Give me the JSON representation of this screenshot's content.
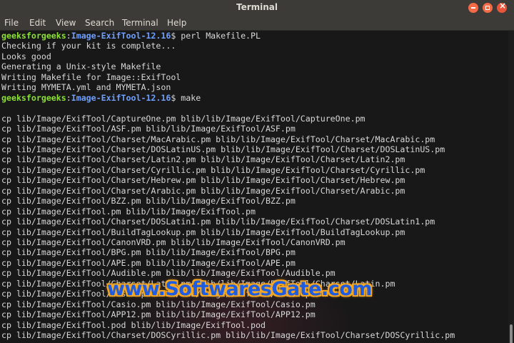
{
  "window": {
    "title": "Terminal"
  },
  "menu": [
    "File",
    "Edit",
    "View",
    "Search",
    "Terminal",
    "Help"
  ],
  "prompt": {
    "user": "geeksforgeeks",
    "path": "Image-ExifTool-12.16"
  },
  "lines": [
    {
      "type": "prompt",
      "cmd": " perl Makefile.PL"
    },
    {
      "type": "out",
      "text": "Checking if your kit is complete..."
    },
    {
      "type": "out",
      "text": "Looks good"
    },
    {
      "type": "out",
      "text": "Generating a Unix-style Makefile"
    },
    {
      "type": "out",
      "text": "Writing Makefile for Image::ExifTool"
    },
    {
      "type": "out",
      "text": "Writing MYMETA.yml and MYMETA.json"
    },
    {
      "type": "prompt",
      "cmd": " make"
    },
    {
      "type": "out",
      "text": ""
    },
    {
      "type": "out",
      "text": "cp lib/Image/ExifTool/CaptureOne.pm blib/lib/Image/ExifTool/CaptureOne.pm"
    },
    {
      "type": "out",
      "text": "cp lib/Image/ExifTool/ASF.pm blib/lib/Image/ExifTool/ASF.pm"
    },
    {
      "type": "out",
      "text": "cp lib/Image/ExifTool/Charset/MacArabic.pm blib/lib/Image/ExifTool/Charset/MacArabic.pm"
    },
    {
      "type": "out",
      "text": "cp lib/Image/ExifTool/Charset/DOSLatinUS.pm blib/lib/Image/ExifTool/Charset/DOSLatinUS.pm"
    },
    {
      "type": "out",
      "text": "cp lib/Image/ExifTool/Charset/Latin2.pm blib/lib/Image/ExifTool/Charset/Latin2.pm"
    },
    {
      "type": "out",
      "text": "cp lib/Image/ExifTool/Charset/Cyrillic.pm blib/lib/Image/ExifTool/Charset/Cyrillic.pm"
    },
    {
      "type": "out",
      "text": "cp lib/Image/ExifTool/Charset/Hebrew.pm blib/lib/Image/ExifTool/Charset/Hebrew.pm"
    },
    {
      "type": "out",
      "text": "cp lib/Image/ExifTool/Charset/Arabic.pm blib/lib/Image/ExifTool/Charset/Arabic.pm"
    },
    {
      "type": "out",
      "text": "cp lib/Image/ExifTool/BZZ.pm blib/lib/Image/ExifTool/BZZ.pm"
    },
    {
      "type": "out",
      "text": "cp lib/Image/ExifTool.pm blib/lib/Image/ExifTool.pm"
    },
    {
      "type": "out",
      "text": "cp lib/Image/ExifTool/Charset/DOSLatin1.pm blib/lib/Image/ExifTool/Charset/DOSLatin1.pm"
    },
    {
      "type": "out",
      "text": "cp lib/Image/ExifTool/BuildTagLookup.pm blib/lib/Image/ExifTool/BuildTagLookup.pm"
    },
    {
      "type": "out",
      "text": "cp lib/Image/ExifTool/CanonVRD.pm blib/lib/Image/ExifTool/CanonVRD.pm"
    },
    {
      "type": "out",
      "text": "cp lib/Image/ExifTool/BPG.pm blib/lib/Image/ExifTool/BPG.pm"
    },
    {
      "type": "out",
      "text": "cp lib/Image/ExifTool/APE.pm blib/lib/Image/ExifTool/APE.pm"
    },
    {
      "type": "out",
      "text": "cp lib/Image/ExifTool/Audible.pm blib/lib/Image/ExifTool/Audible.pm"
    },
    {
      "type": "out",
      "text": "cp lib/Image/ExifTool/Charset/Latin.pm blib/lib/Image/ExifTool/Charset/Latin.pm"
    },
    {
      "type": "out",
      "text": "cp lib/Image/ExifTool/Casio.pm blib/lib/Image/ExifTool/Casio.pm"
    },
    {
      "type": "out",
      "text": "cp lib/Image/ExifTool/Casio.pm blib/lib/Image/ExifTool/Casio.pm"
    },
    {
      "type": "out",
      "text": "cp lib/Image/ExifTool/APP12.pm blib/lib/Image/ExifTool/APP12.pm"
    },
    {
      "type": "out",
      "text": "cp lib/Image/ExifTool.pod blib/lib/Image/ExifTool.pod"
    },
    {
      "type": "out",
      "text": "cp lib/Image/ExifTool/Charset/DOSCyrillic.pm blib/lib/Image/ExifTool/Charset/DOSCyrillic.pm"
    }
  ],
  "watermark": "www.SoftwaresGate.com",
  "colors": {
    "prompt_user": "#8ae234",
    "prompt_path": "#6fa0ff",
    "text": "#d8d8d8",
    "background": "#181818"
  }
}
